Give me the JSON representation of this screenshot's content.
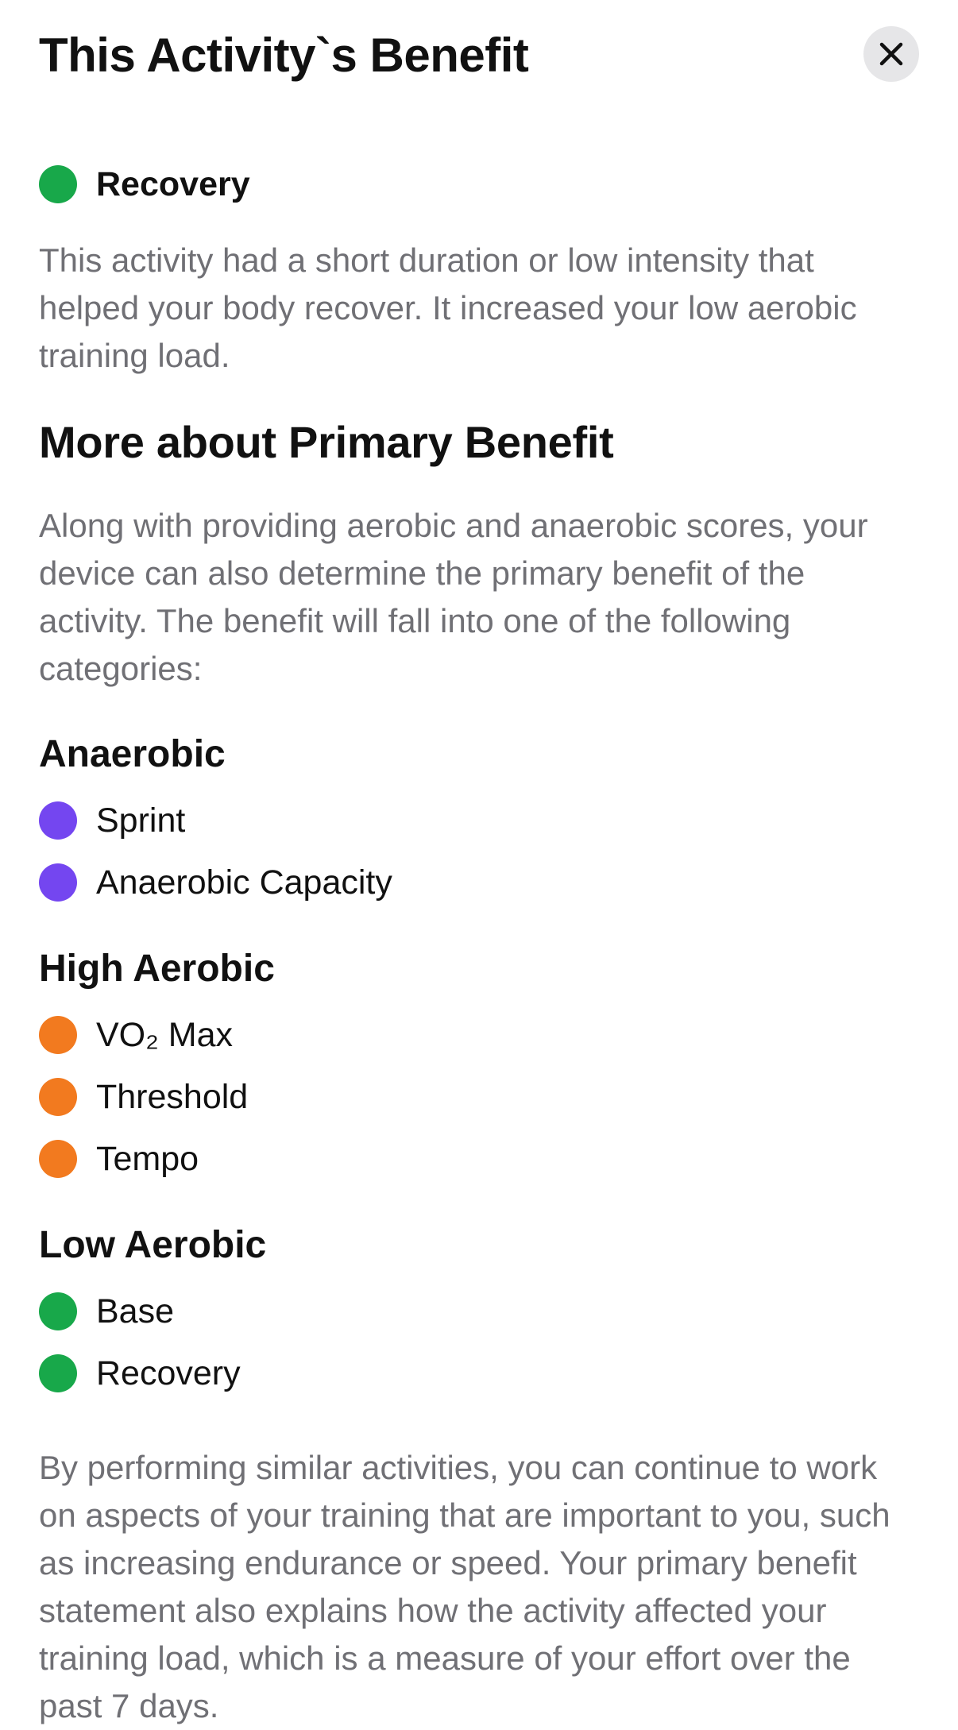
{
  "header": {
    "title": "This Activity`s Benefit",
    "close_icon": "close-icon"
  },
  "current_benefit": {
    "label": "Recovery",
    "color": "#18a84a",
    "description": "This activity had a short duration or low intensity that helped your body recover. It increased your low aerobic training load."
  },
  "primary_benefit": {
    "section_title": "More about Primary Benefit",
    "intro": "Along with providing aerobic and anaerobic scores, your device can also determine the primary benefit of the activity. The benefit will fall into one of the following categories:"
  },
  "categories": [
    {
      "title": "Anaerobic",
      "color": "#7446f0",
      "items": [
        "Sprint",
        "Anaerobic Capacity"
      ]
    },
    {
      "title": "High Aerobic",
      "color": "#f27a1f",
      "items": [
        "VO₂ Max",
        "Threshold",
        "Tempo"
      ]
    },
    {
      "title": "Low Aerobic",
      "color": "#18a84a",
      "items": [
        "Base",
        "Recovery"
      ]
    }
  ],
  "footer_text": "By performing similar activities, you can continue to work on aspects of your training that are important to you, such as increasing endurance or speed. Your primary benefit statement also explains how the activity affected your training load, which is a measure of your effort over the past 7 days."
}
